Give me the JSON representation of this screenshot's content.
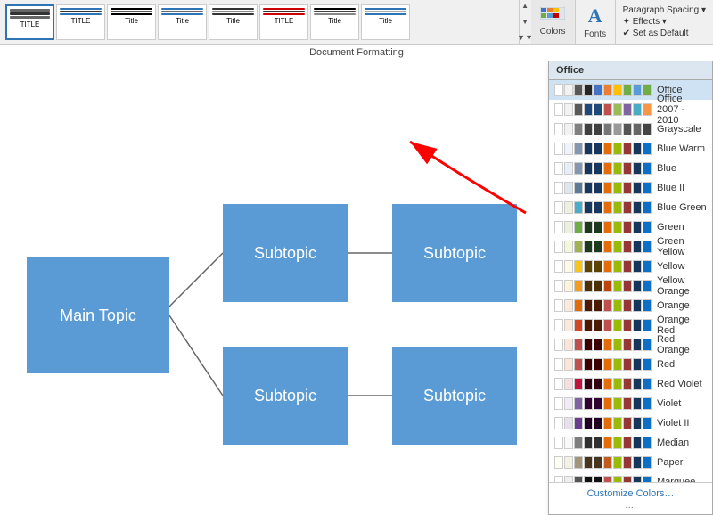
{
  "toolbar": {
    "doc_label": "Document Formatting",
    "colors_label": "Colors",
    "fonts_label": "Fonts",
    "paragraph_spacing": "Paragraph Spacing ▾",
    "effects": "✦ Effects ▾",
    "set_default": "✔ Set as Default",
    "scroll_up": "▲",
    "scroll_down": "▼"
  },
  "styles": [
    {
      "label": "TITLE",
      "type": "title"
    },
    {
      "label": "TITLE",
      "type": "title2"
    },
    {
      "label": "Title",
      "type": "title3"
    },
    {
      "label": "Title",
      "type": "title4"
    },
    {
      "label": "Title",
      "type": "title5"
    },
    {
      "label": "TITLE",
      "type": "title6"
    },
    {
      "label": "Title",
      "type": "title7"
    },
    {
      "label": "Title",
      "type": "title8"
    }
  ],
  "panel": {
    "header": "Office",
    "customize": "Customize Colors…",
    "more": "…."
  },
  "themes": [
    {
      "name": "Office",
      "swatches": [
        "#fff",
        "#f2f2f2",
        "#595959",
        "#262626",
        "#4472c4",
        "#ed7d31",
        "#ffc000",
        "#70ad47",
        "#5b9bd5",
        "#70ad47"
      ]
    },
    {
      "name": "Office 2007 - 2010",
      "swatches": [
        "#fff",
        "#f2f2f2",
        "#595959",
        "#1f497d",
        "#1f497d",
        "#c0504d",
        "#9bbb59",
        "#8064a2",
        "#4bacc6",
        "#f79646"
      ]
    },
    {
      "name": "Grayscale",
      "swatches": [
        "#fff",
        "#f2f2f2",
        "#808080",
        "#404040",
        "#404040",
        "#777",
        "#999",
        "#555",
        "#666",
        "#444"
      ]
    },
    {
      "name": "Blue Warm",
      "swatches": [
        "#fff",
        "#eff3fb",
        "#8496b0",
        "#17375e",
        "#17375e",
        "#e36c09",
        "#99bb07",
        "#953734",
        "#16365c",
        "#0f6fc6"
      ]
    },
    {
      "name": "Blue",
      "swatches": [
        "#fff",
        "#e8eef7",
        "#8496b0",
        "#17375e",
        "#17375e",
        "#e36c09",
        "#99bb07",
        "#953734",
        "#16365c",
        "#0f6fc6"
      ]
    },
    {
      "name": "Blue II",
      "swatches": [
        "#fff",
        "#dce6f1",
        "#5f7a96",
        "#17375e",
        "#17375e",
        "#e36c09",
        "#99bb07",
        "#953734",
        "#16365c",
        "#0f6fc6"
      ]
    },
    {
      "name": "Blue Green",
      "swatches": [
        "#fff",
        "#ebf1dd",
        "#4bacc6",
        "#17375e",
        "#17375e",
        "#e36c09",
        "#99bb07",
        "#953734",
        "#16365c",
        "#0f6fc6"
      ]
    },
    {
      "name": "Green",
      "swatches": [
        "#fff",
        "#ebf1dd",
        "#70ad47",
        "#1e3a1e",
        "#1e3a1e",
        "#e36c09",
        "#99bb07",
        "#953734",
        "#16365c",
        "#0f6fc6"
      ]
    },
    {
      "name": "Green Yellow",
      "swatches": [
        "#fff",
        "#f3f8d8",
        "#a0b350",
        "#1e3a1e",
        "#1e3a1e",
        "#e36c09",
        "#99bb07",
        "#953734",
        "#16365c",
        "#0f6fc6"
      ]
    },
    {
      "name": "Yellow",
      "swatches": [
        "#fff",
        "#fffae5",
        "#f5c518",
        "#5c4300",
        "#5c4300",
        "#e36c09",
        "#99bb07",
        "#953734",
        "#16365c",
        "#0f6fc6"
      ]
    },
    {
      "name": "Yellow Orange",
      "swatches": [
        "#fff",
        "#fff3d8",
        "#f59b1e",
        "#4c3000",
        "#4c3000",
        "#c0440a",
        "#99bb07",
        "#953734",
        "#16365c",
        "#0f6fc6"
      ]
    },
    {
      "name": "Orange",
      "swatches": [
        "#fff",
        "#fde9d9",
        "#e36c09",
        "#4c1a00",
        "#4c1a00",
        "#c0504d",
        "#99bb07",
        "#953734",
        "#16365c",
        "#0f6fc6"
      ]
    },
    {
      "name": "Orange Red",
      "swatches": [
        "#fff",
        "#fde9d9",
        "#d24726",
        "#4c1a00",
        "#4c1a00",
        "#c0504d",
        "#99bb07",
        "#953734",
        "#16365c",
        "#0f6fc6"
      ]
    },
    {
      "name": "Red Orange",
      "swatches": [
        "#fff",
        "#fce4d6",
        "#c0504d",
        "#3c0000",
        "#3c0000",
        "#e36c09",
        "#99bb07",
        "#953734",
        "#16365c",
        "#0f6fc6"
      ]
    },
    {
      "name": "Red",
      "swatches": [
        "#fff",
        "#fce4d6",
        "#c0504d",
        "#3c0000",
        "#3c0000",
        "#e36c09",
        "#99bb07",
        "#953734",
        "#16365c",
        "#0f6fc6"
      ]
    },
    {
      "name": "Red Violet",
      "swatches": [
        "#fff",
        "#f9dde0",
        "#c0143c",
        "#330011",
        "#330011",
        "#e36c09",
        "#99bb07",
        "#953734",
        "#16365c",
        "#0f6fc6"
      ]
    },
    {
      "name": "Violet",
      "swatches": [
        "#fff",
        "#f2eaf5",
        "#8064a2",
        "#330033",
        "#330033",
        "#e36c09",
        "#99bb07",
        "#953734",
        "#16365c",
        "#0f6fc6"
      ]
    },
    {
      "name": "Violet II",
      "swatches": [
        "#fff",
        "#e8dfed",
        "#6a3d8f",
        "#220022",
        "#220022",
        "#e36c09",
        "#99bb07",
        "#953734",
        "#16365c",
        "#0f6fc6"
      ]
    },
    {
      "name": "Median",
      "swatches": [
        "#fff",
        "#f9f9f9",
        "#7e7e7e",
        "#303030",
        "#303030",
        "#e36c09",
        "#99bb07",
        "#953734",
        "#16365c",
        "#0f6fc6"
      ]
    },
    {
      "name": "Paper",
      "swatches": [
        "#fffef5",
        "#f3f1e4",
        "#a1957b",
        "#48351e",
        "#48351e",
        "#c15b1e",
        "#99bb07",
        "#953734",
        "#16365c",
        "#0f6fc6"
      ]
    },
    {
      "name": "Marquee",
      "swatches": [
        "#fff",
        "#efefef",
        "#555555",
        "#111111",
        "#111111",
        "#c0504d",
        "#99bb07",
        "#953734",
        "#16365c",
        "#0f6fc6"
      ]
    }
  ],
  "mindmap": {
    "main_topic": "Main Topic",
    "subtopic1": "Subtopic",
    "subtopic2": "Subtopic",
    "subtopic3": "Subtopic",
    "subtopic4": "Subtopic"
  },
  "colors": {
    "box_fill": "#5b9bd5",
    "box_text": "#ffffff",
    "connector": "#666666"
  }
}
